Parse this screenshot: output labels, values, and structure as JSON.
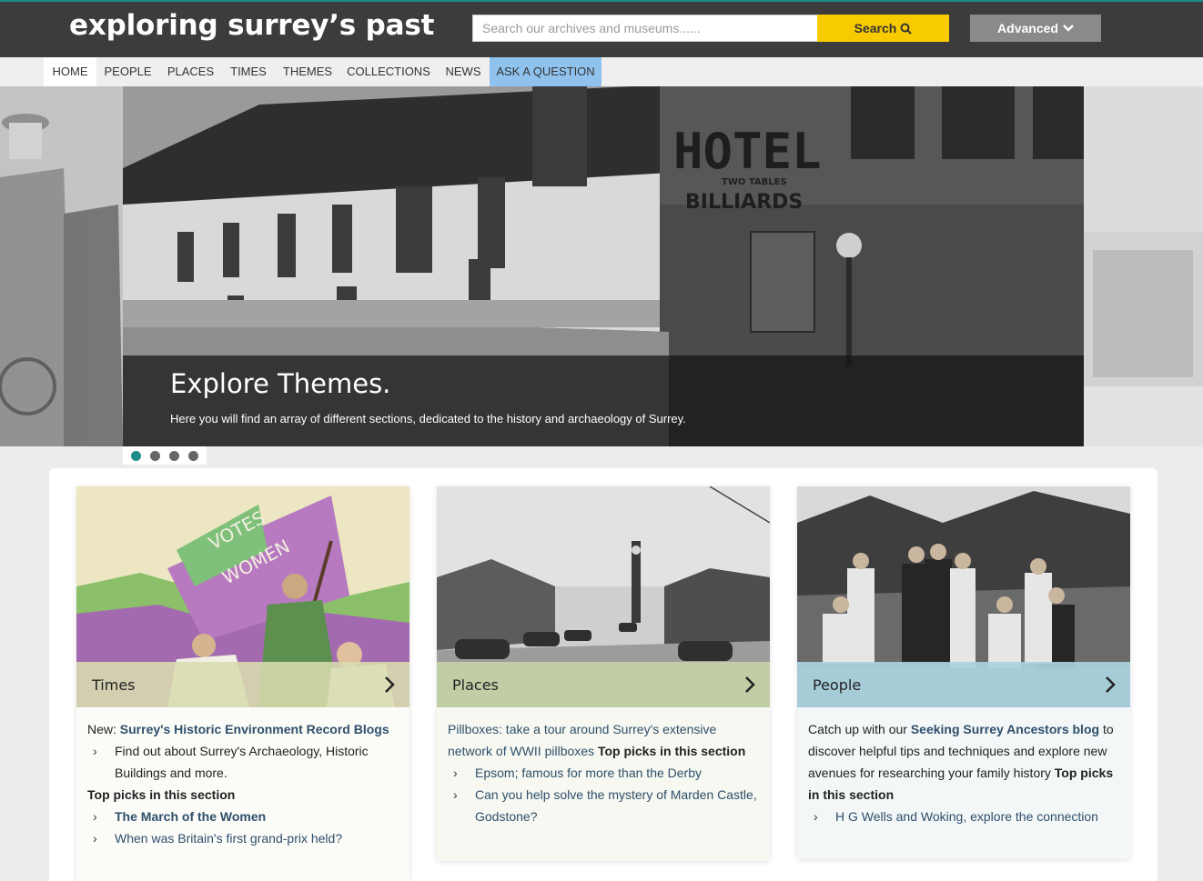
{
  "header": {
    "logo": "exploring surrey’s past",
    "search_placeholder": "Search our archives and museums......",
    "search_label": "Search",
    "advanced_label": "Advanced"
  },
  "nav": [
    "HOME",
    "PEOPLE",
    "PLACES",
    "TIMES",
    "THEMES",
    "COLLECTIONS",
    "NEWS",
    "ASK A QUESTION"
  ],
  "hero": {
    "title": "Explore Themes.",
    "subtitle": "Here you will find an array of different sections, dedicated to the history and archaeology of Surrey.",
    "sign_hotel": "HOTEL",
    "sign_tables": "TWO TABLES",
    "sign_billiards": "BILLIARDS"
  },
  "cards": {
    "times": {
      "label": "Times",
      "intro": "New: ",
      "intro_link": "Surrey's Historic Environment Record Blogs",
      "item1": "Find out about Surrey's Archaeology, Historic Buildings and more.",
      "top_picks": "Top picks in this section",
      "item2": "The March of the Women",
      "item3": "When was Britain's first grand-prix held?"
    },
    "places": {
      "label": "Places",
      "intro": "Pillboxes: take a tour around Surrey's extensive network of WWII pillboxes",
      "top_picks": "Top picks in this section",
      "item1": "Epsom; famous for more than the Derby",
      "item2": "Can you help solve the mystery of Marden Castle, Godstone?"
    },
    "people": {
      "label": "People",
      "intro_a": "Catch up with our ",
      "intro_link": "Seeking Surrey Ancestors blog",
      "intro_b": " to discover helpful tips and techniques and explore new avenues for researching your family history ",
      "top_picks": "Top picks in this section",
      "item1": "H G Wells and Woking, explore the connection"
    }
  },
  "colors": {
    "topbar": "#3c3c3c",
    "search_button": "#f7cb00",
    "advanced_button": "#8a8a8a",
    "ask_tab": "#8fc3ee",
    "times_label_bg": "#d8dcae",
    "places_label_bg": "#c4d3a6",
    "people_label_bg": "#a9d2df",
    "active_dot": "#1f8a8a"
  }
}
